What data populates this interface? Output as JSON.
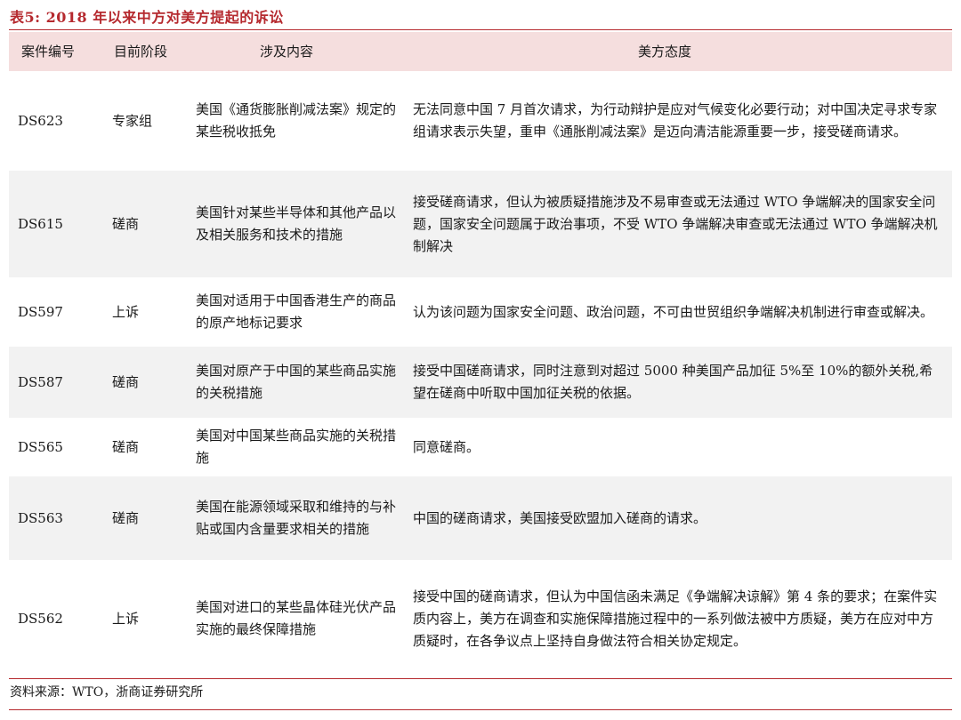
{
  "caption": "表5:  2018 年以来中方对美方提起的诉讼",
  "colors": {
    "accent": "#b5292e",
    "header_bg": "#f5dede",
    "row_shade": "#f2f2f2"
  },
  "table": {
    "headers": [
      "案件编号",
      "目前阶段",
      "涉及内容",
      "美方态度"
    ],
    "rows": [
      {
        "case": "DS623",
        "stage": "专家组",
        "content": "美国《通货膨胀削减法案》规定的某些税收抵免",
        "attitude": "无法同意中国 7 月首次请求，为行动辩护是应对气候变化必要行动；对中国决定寻求专家组请求表示失望，重申《通胀削减法案》是迈向清洁能源重要一步，接受磋商请求。"
      },
      {
        "case": "DS615",
        "stage": "磋商",
        "content": "美国针对某些半导体和其他产品以及相关服务和技术的措施",
        "attitude": "接受磋商请求，但认为被质疑措施涉及不易审查或无法通过 WTO 争端解决的国家安全问题，国家安全问题属于政治事项，不受 WTO 争端解决审查或无法通过 WTO 争端解决机制解决"
      },
      {
        "case": "DS597",
        "stage": "上诉",
        "content": "美国对适用于中国香港生产的商品的原产地标记要求",
        "attitude": "认为该问题为国家安全问题、政治问题，不可由世贸组织争端解决机制进行审查或解决。"
      },
      {
        "case": "DS587",
        "stage": "磋商",
        "content": "美国对原产于中国的某些商品实施的关税措施",
        "attitude": "接受中国磋商请求，同时注意到对超过 5000 种美国产品加征 5%至 10%的额外关税,希望在磋商中听取中国加征关税的依据。"
      },
      {
        "case": "DS565",
        "stage": "磋商",
        "content": "美国对中国某些商品实施的关税措施",
        "attitude": "同意磋商。"
      },
      {
        "case": "DS563",
        "stage": "磋商",
        "content": "美国在能源领域采取和维持的与补贴或国内含量要求相关的措施",
        "attitude": "中国的磋商请求，美国接受欧盟加入磋商的请求。"
      },
      {
        "case": "DS562",
        "stage": "上诉",
        "content": "美国对进口的某些晶体硅光伏产品实施的最终保障措施",
        "attitude": "接受中国的磋商请求，但认为中国信函未满足《争端解决谅解》第 4 条的要求；在案件实质内容上，美方在调查和实施保障措施过程中的一系列做法被中方质疑，美方在应对中方质疑时，在各争议点上坚持自身做法符合相关协定规定。"
      }
    ]
  },
  "source": "资料来源：WTO，浙商证券研究所"
}
